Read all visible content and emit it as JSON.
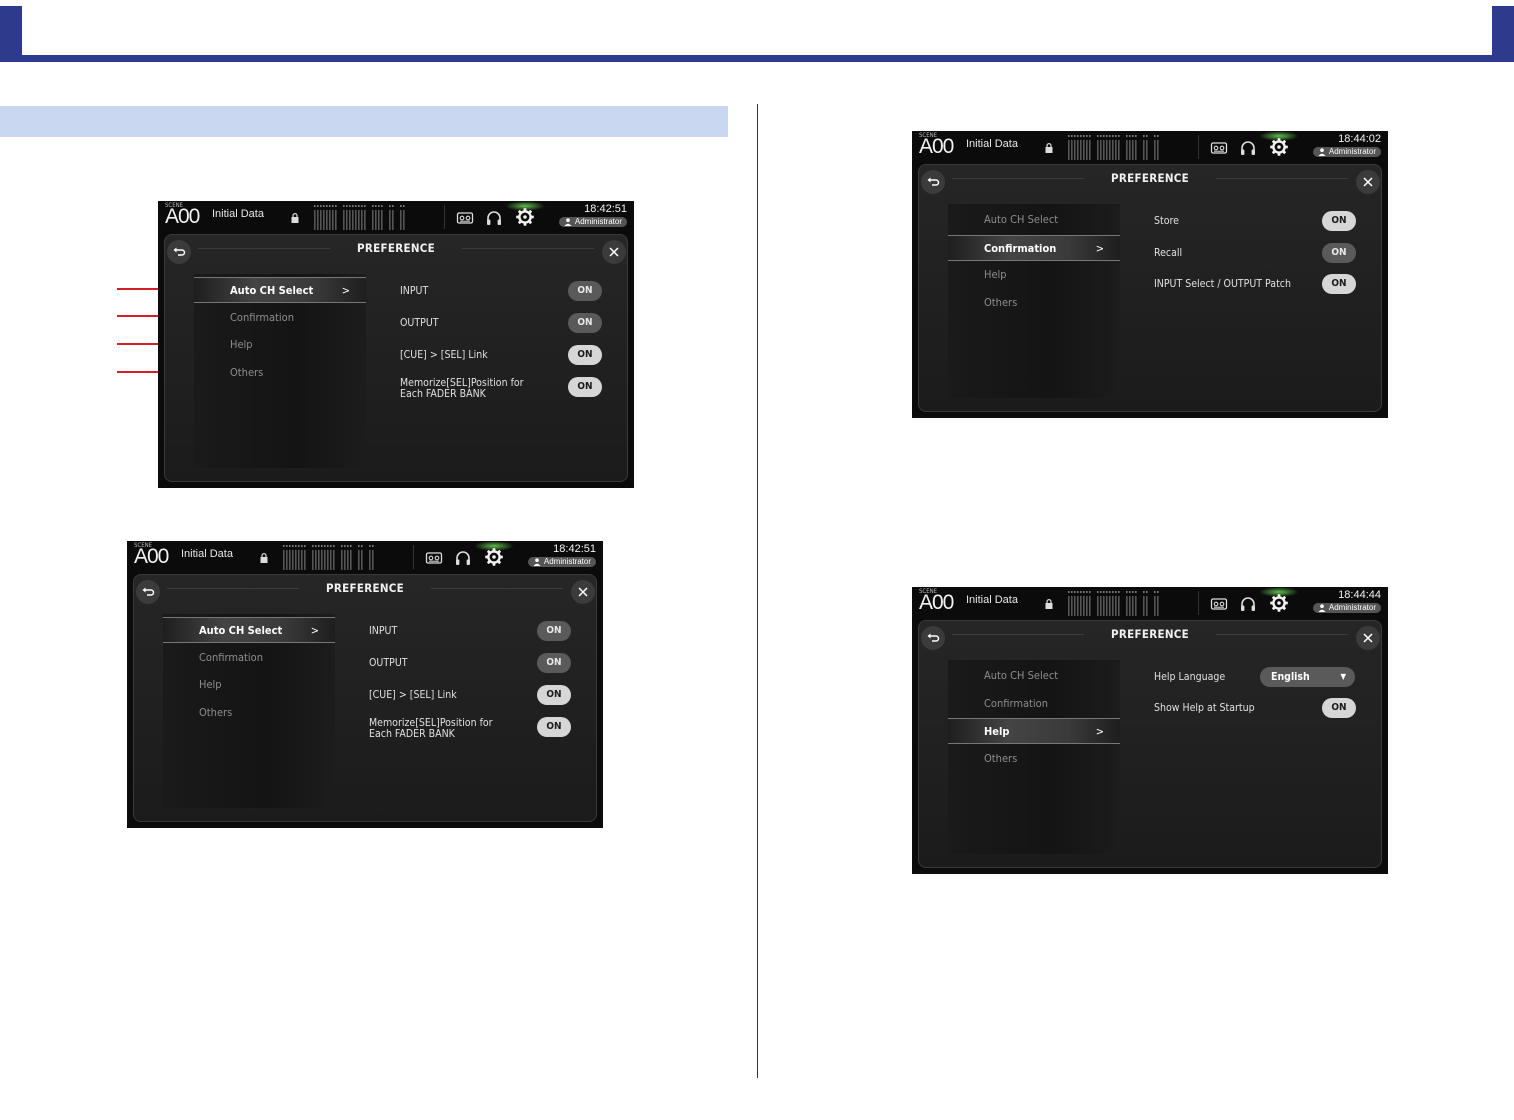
{
  "colors": {
    "brand": "#2e3a8c",
    "section_band": "#c9d8f0",
    "callout": "#d21f26",
    "glow": "#6edc5a"
  },
  "screens": [
    {
      "scene_label": "SCENE",
      "scene_number": "A00",
      "scene_name": "Initial Data",
      "time": "18:42:51",
      "user": "Administrator",
      "title": "PREFERENCE",
      "menu": [
        {
          "label": "Auto CH Select",
          "selected": true,
          "chevron": ">"
        },
        {
          "label": "Confirmation"
        },
        {
          "label": "Help"
        },
        {
          "label": "Others"
        }
      ],
      "options": [
        {
          "label": "INPUT",
          "value": "ON",
          "state": "dim"
        },
        {
          "label": "OUTPUT",
          "value": "ON",
          "state": "dim"
        },
        {
          "label": "[CUE] > [SEL] Link",
          "value": "ON",
          "state": "bright"
        },
        {
          "label": "Memorize[SEL]Position for",
          "label2": "Each FADER BANK",
          "value": "ON",
          "state": "bright"
        }
      ]
    },
    {
      "scene_label": "SCENE",
      "scene_number": "A00",
      "scene_name": "Initial Data",
      "time": "18:42:51",
      "user": "Administrator",
      "title": "PREFERENCE",
      "menu": [
        {
          "label": "Auto CH Select",
          "selected": true,
          "chevron": ">"
        },
        {
          "label": "Confirmation"
        },
        {
          "label": "Help"
        },
        {
          "label": "Others"
        }
      ],
      "options": [
        {
          "label": "INPUT",
          "value": "ON",
          "state": "dim"
        },
        {
          "label": "OUTPUT",
          "value": "ON",
          "state": "dim"
        },
        {
          "label": "[CUE] > [SEL] Link",
          "value": "ON",
          "state": "bright"
        },
        {
          "label": "Memorize[SEL]Position for",
          "label2": "Each FADER BANK",
          "value": "ON",
          "state": "bright"
        }
      ]
    },
    {
      "scene_label": "SCENE",
      "scene_number": "A00",
      "scene_name": "Initial Data",
      "time": "18:44:02",
      "user": "Administrator",
      "title": "PREFERENCE",
      "menu": [
        {
          "label": "Auto CH Select"
        },
        {
          "label": "Confirmation",
          "selected": true,
          "chevron": ">"
        },
        {
          "label": "Help"
        },
        {
          "label": "Others"
        }
      ],
      "options": [
        {
          "label": "Store",
          "value": "ON",
          "state": "bright"
        },
        {
          "label": "Recall",
          "value": "ON",
          "state": "dim"
        },
        {
          "label": "INPUT Select / OUTPUT Patch",
          "value": "ON",
          "state": "bright"
        }
      ]
    },
    {
      "scene_label": "SCENE",
      "scene_number": "A00",
      "scene_name": "Initial Data",
      "time": "18:44:44",
      "user": "Administrator",
      "title": "PREFERENCE",
      "menu": [
        {
          "label": "Auto CH Select"
        },
        {
          "label": "Confirmation"
        },
        {
          "label": "Help",
          "selected": true,
          "chevron": ">"
        },
        {
          "label": "Others"
        }
      ],
      "help_language": {
        "label": "Help Language",
        "value": "English"
      },
      "options": [
        {
          "label": "Show Help at Startup",
          "value": "ON",
          "state": "bright"
        }
      ]
    }
  ]
}
